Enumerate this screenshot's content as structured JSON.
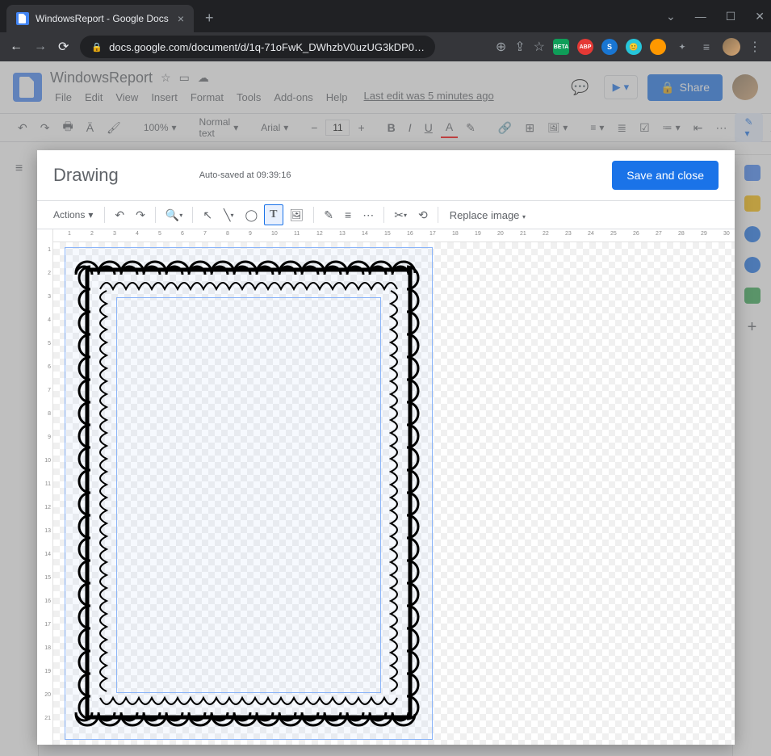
{
  "browser": {
    "tab_title": "WindowsReport - Google Docs",
    "url": "docs.google.com/document/d/1q-71oFwK_DWhzbV0uzUG3kDP0…",
    "new_tab": "+",
    "close_tab": "×",
    "win_min": "—",
    "win_max": "☐",
    "win_close": "✕",
    "win_dropdown": "⌄",
    "nav_back": "←",
    "nav_fwd": "→",
    "nav_reload": "⟳",
    "addr_lock": "🔒",
    "addr_search": "⊕",
    "addr_share": "⇪",
    "addr_star": "☆",
    "ext_beta": "BETA",
    "ext_abp": "ABP",
    "ext_s": "S",
    "ext_face": "😊",
    "ext_puzzle": "✦",
    "ext_list": "≡",
    "menu": "⋮"
  },
  "docs": {
    "title": "WindowsReport",
    "star": "☆",
    "move": "▭",
    "cloud": "☁",
    "menus": [
      "File",
      "Edit",
      "View",
      "Insert",
      "Format",
      "Tools",
      "Add-ons",
      "Help"
    ],
    "last_edit": "Last edit was 5 minutes ago",
    "comments_icon": "💬",
    "present_icon": "▶",
    "present_plus": "▾",
    "share_lock": "🔒",
    "share_label": "Share",
    "toolbar": {
      "undo": "↶",
      "redo": "↷",
      "print": "🖶",
      "spell": "Ӓ",
      "paint": "🖌",
      "zoom": "100%",
      "zoom_arrow": "▾",
      "style": "Normal text",
      "style_arrow": "▾",
      "font": "Arial",
      "font_arrow": "▾",
      "size_minus": "−",
      "size": "11",
      "size_plus": "+",
      "bold": "B",
      "italic": "I",
      "underline": "U",
      "color": "A",
      "highlight": "✎",
      "link": "🔗",
      "comment": "⊞",
      "image": "🖼",
      "image_arrow": "▾",
      "align": "≡",
      "align_arrow": "▾",
      "line": "≣",
      "checklist": "☑",
      "bullets": "≔",
      "bullets_arrow": "▾",
      "numbers": "≕",
      "indent_dec": "⇤",
      "more": "⋯",
      "pen": "✎",
      "pen_arrow": "▾",
      "chevron": "ᐱ"
    }
  },
  "outline": {
    "icon1": "≡",
    "icon2": "▢"
  },
  "sidepanel": {
    "plus": "+"
  },
  "drawing": {
    "title": "Drawing",
    "autosave": "Auto-saved at 09:39:16",
    "save_close": "Save and close",
    "toolbar": {
      "actions": "Actions",
      "actions_arrow": "▾",
      "undo": "↶",
      "redo": "↷",
      "zoom": "🔍",
      "zoom_arrow": "▾",
      "select": "↖",
      "line": "╲",
      "line_arrow": "▾",
      "shape": "◯",
      "text": "T",
      "image": "🖼",
      "bordercolor": "✎",
      "borderweight": "≡",
      "borderdash": "⋯",
      "crop": "✂",
      "crop_arrow": "▾",
      "reset": "⟲",
      "replace": "Replace image",
      "replace_arrow": "▾"
    },
    "hruler": [
      1,
      2,
      3,
      4,
      5,
      6,
      7,
      8,
      9,
      10,
      11,
      12,
      13,
      14,
      15,
      16,
      17,
      18,
      19,
      20,
      21,
      22,
      23,
      24,
      25,
      26,
      27,
      28,
      29,
      30
    ],
    "vruler": [
      1,
      2,
      3,
      4,
      5,
      6,
      7,
      8,
      9,
      10,
      11,
      12,
      13,
      14,
      15,
      16,
      17,
      18,
      19,
      20,
      21
    ]
  }
}
